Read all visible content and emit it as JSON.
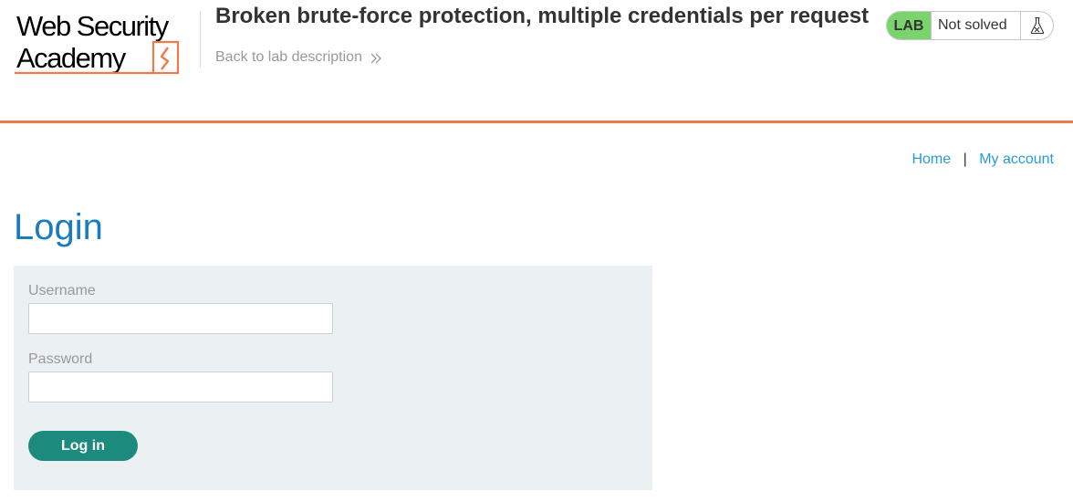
{
  "header": {
    "logo_alt": "Web Security Academy",
    "logo_line1": "Web Security",
    "logo_line2": "Academy",
    "lab_title": "Broken brute-force protection, multiple credentials per request",
    "back_link": "Back to lab description",
    "status": {
      "tag": "LAB",
      "text": "Not solved",
      "icon": "flask-icon",
      "tag_color": "#7ad36d"
    },
    "accent_color": "#ef7a4c"
  },
  "nav": {
    "home": "Home",
    "separator": "|",
    "my_account": "My account"
  },
  "main": {
    "title": "Login",
    "form": {
      "username_label": "Username",
      "username_value": "",
      "password_label": "Password",
      "password_value": "",
      "submit_label": "Log in",
      "button_color": "#1c8b7d"
    }
  }
}
